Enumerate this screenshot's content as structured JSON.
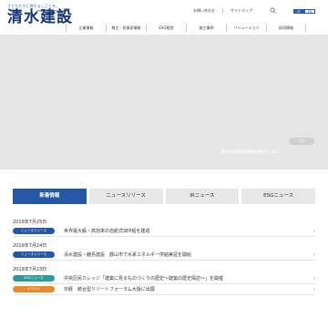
{
  "header": {
    "tagline": "子どもたちに誇れるしごとを。",
    "corp_en": "SHIMIZU CORPORATION",
    "logo_text": "清水建設",
    "utility": {
      "contact": "お問い合わせ",
      "sitemap": "サイトマップ",
      "lang_ja": "JP",
      "lang_en": "EN"
    },
    "nav": [
      "企業情報",
      "株主・投資家情報",
      "ESG経営",
      "施工事例",
      "ソリューション",
      "採用情報"
    ]
  },
  "hero": {
    "caption": "西日本旅客鉄道株式会社 / XXX",
    "pager": "1/5"
  },
  "tabs": [
    "新着情報",
    "ニュースリリース",
    "IRニュース",
    "ESGニュース"
  ],
  "news": [
    {
      "date": "2019年7月25日",
      "items": [
        {
          "badge": "ニュースリリース",
          "badge_color": "#2458a6",
          "title": "世界最大級・高効率の自航式SEP船を建造"
        }
      ]
    },
    {
      "date": "2019年7月24日",
      "items": [
        {
          "badge": "ニュースリリース",
          "badge_color": "#2458a6",
          "title": "清水建設・鹿島建設　郡山市で水素エネルギー供給実証を開始"
        }
      ]
    },
    {
      "date": "2019年7月23日",
      "items": [
        {
          "badge": "ESGニュース",
          "badge_color": "#2e9b9b",
          "title": "中央区民カレッジ「建築に見るものづくりの歴史～建築の歴史探訪～」を開催"
        },
        {
          "badge": "イベント",
          "badge_color": "#e98a2a",
          "title": "日経　統合型リゾートフォーラム大阪に出展"
        }
      ]
    }
  ]
}
